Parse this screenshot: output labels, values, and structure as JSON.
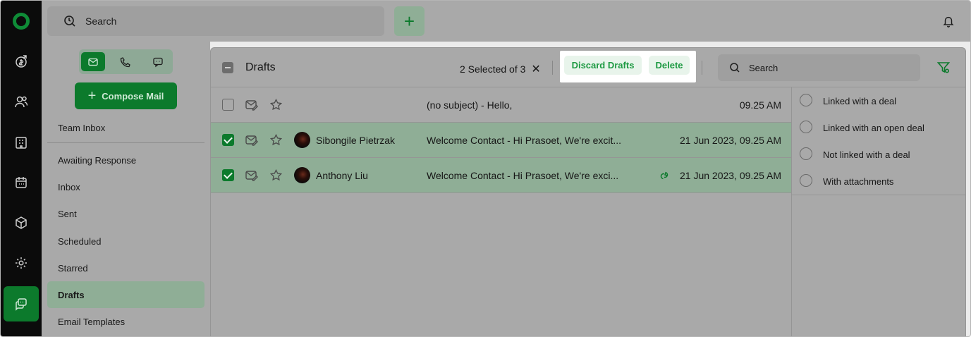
{
  "topbar": {
    "search_label": "Search"
  },
  "sidebar": {
    "compose_label": "Compose Mail",
    "team_inbox": "Team Inbox",
    "folders": [
      {
        "label": "Awaiting Response"
      },
      {
        "label": "Inbox"
      },
      {
        "label": "Sent"
      },
      {
        "label": "Scheduled"
      },
      {
        "label": "Starred"
      },
      {
        "label": "Drafts",
        "selected": true
      },
      {
        "label": "Email Templates"
      }
    ]
  },
  "main": {
    "title": "Drafts",
    "selection_text": "2 Selected of 3",
    "clear_selection": "✕",
    "discard_label": "Discard Drafts",
    "delete_label": "Delete",
    "search_label": "Search"
  },
  "emails": [
    {
      "selected": false,
      "name": "",
      "subject": "(no subject)  -  Hello,",
      "linked": false,
      "date": "09.25 AM"
    },
    {
      "selected": true,
      "name": "Sibongile Pietrzak",
      "subject": "Welcome Contact  -  Hi Prasoet, We're excit...",
      "linked": false,
      "date": "21 Jun 2023, 09.25 AM"
    },
    {
      "selected": true,
      "name": "Anthony Liu",
      "subject": "Welcome Contact  -  Hi Prasoet, We're exci...",
      "linked": true,
      "date": "21 Jun 2023, 09.25 AM"
    }
  ],
  "filters": [
    {
      "label": "Linked with a deal"
    },
    {
      "label": "Linked with an open deal"
    },
    {
      "label": "Not linked with a deal"
    },
    {
      "label": "With attachments"
    }
  ],
  "colors": {
    "accent": "#0c7a2c",
    "highlight_pill_text": "#1e9a43",
    "selected_row": "#8fae96"
  }
}
